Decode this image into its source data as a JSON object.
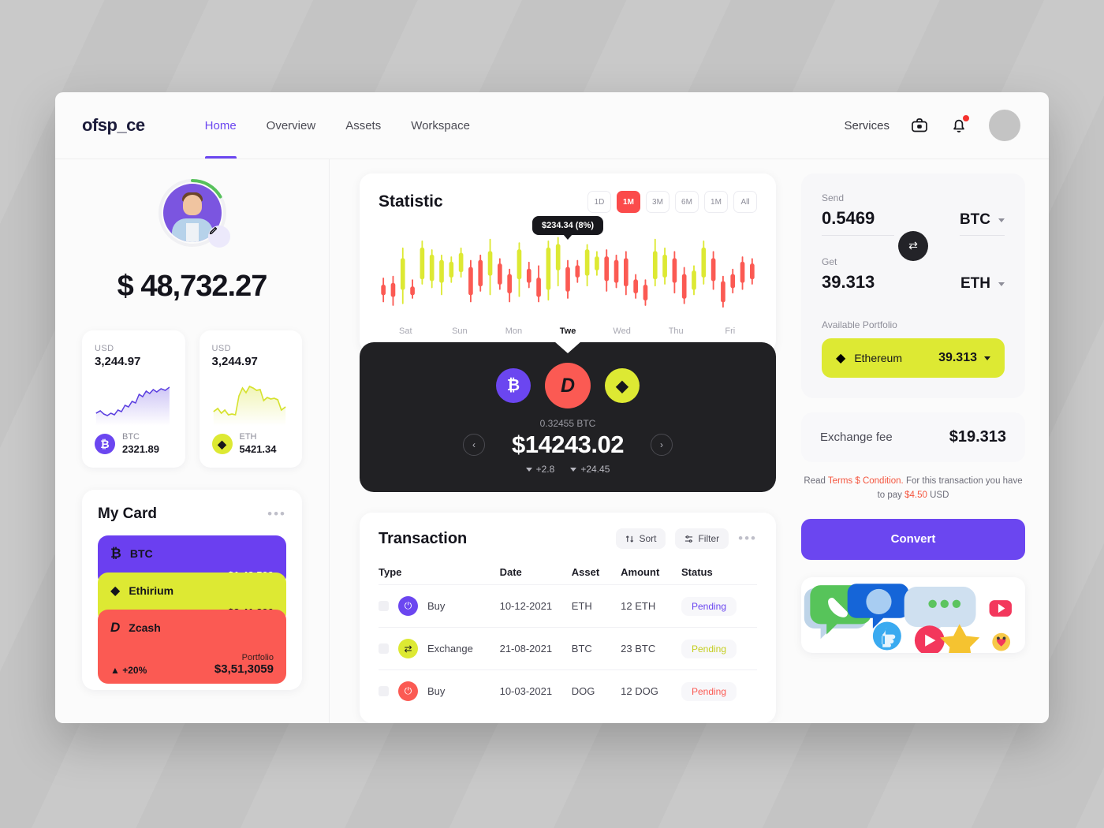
{
  "header": {
    "logo": "ofsp_ce",
    "nav": [
      {
        "label": "Home",
        "active": true
      },
      {
        "label": "Overview",
        "active": false
      },
      {
        "label": "Assets",
        "active": false
      },
      {
        "label": "Workspace",
        "active": false
      }
    ],
    "services_label": "Services",
    "icons": [
      "briefcase-icon",
      "bell-icon"
    ],
    "notification_color": "#f5322e"
  },
  "profile": {
    "balance": "$ 48,732.27",
    "ring_color": "#57c15c",
    "edit_icon": "pencil-icon"
  },
  "mini_cards": [
    {
      "currency": "USD",
      "value": "3,244.97",
      "symbol": "BTC",
      "amount": "2321.89",
      "color": "#6b46f0",
      "glyph": "₿",
      "spark_color": "#5b3fe0"
    },
    {
      "currency": "USD",
      "value": "3,244.97",
      "symbol": "ETH",
      "amount": "5421.34",
      "color": "#dde933",
      "glyph": "◆",
      "spark_color": "#d6e22f"
    }
  ],
  "my_card": {
    "title": "My Card",
    "menu_icon": "more-dots-icon",
    "cards": [
      {
        "name": "BTC",
        "amount": "$1,43,509",
        "color": "#6b3ff0",
        "glyph": "₿"
      },
      {
        "name": "Ethirium",
        "amount": "$3,41,890",
        "color": "#dde933",
        "glyph": "◆"
      },
      {
        "name": "Zcash",
        "amount": "",
        "color": "#fb5a53",
        "glyph": "D",
        "portfolio_label": "Portfolio",
        "portfolio_value": "$3,51,3059",
        "change": "+20%"
      }
    ]
  },
  "statistic": {
    "title": "Statistic",
    "ranges": [
      {
        "label": "1D",
        "active": false
      },
      {
        "label": "1M",
        "active": true
      },
      {
        "label": "3M",
        "active": false
      },
      {
        "label": "6M",
        "active": false
      },
      {
        "label": "1M",
        "active": false
      },
      {
        "label": "All",
        "active": false
      }
    ],
    "tooltip": "$234.34 (8%)",
    "active_range_color": "#fb4b4b"
  },
  "chart_data": {
    "type": "candlestick",
    "title": "Statistic",
    "xlabel": "",
    "ylabel": "",
    "grid": false,
    "categories": [
      "Sat",
      "Sun",
      "Mon",
      "Twe",
      "Wed",
      "Thu",
      "Fri"
    ],
    "active_category": "Twe",
    "annotation": "$234.34 (8%)",
    "up_color": "#dde933",
    "down_color": "#fb5a53",
    "candles": [
      {
        "open": 30,
        "close": 42,
        "low": 22,
        "high": 50,
        "dir": "down"
      },
      {
        "open": 28,
        "close": 44,
        "low": 18,
        "high": 52,
        "dir": "down"
      },
      {
        "open": 36,
        "close": 72,
        "low": 20,
        "high": 84,
        "dir": "up"
      },
      {
        "open": 30,
        "close": 40,
        "low": 26,
        "high": 48,
        "dir": "down"
      },
      {
        "open": 48,
        "close": 84,
        "low": 42,
        "high": 92,
        "dir": "up"
      },
      {
        "open": 46,
        "close": 76,
        "low": 38,
        "high": 82,
        "dir": "up"
      },
      {
        "open": 44,
        "close": 70,
        "low": 30,
        "high": 76,
        "dir": "up"
      },
      {
        "open": 50,
        "close": 68,
        "low": 44,
        "high": 74,
        "dir": "up"
      },
      {
        "open": 56,
        "close": 78,
        "low": 50,
        "high": 84,
        "dir": "up"
      },
      {
        "open": 30,
        "close": 62,
        "low": 22,
        "high": 70,
        "dir": "down"
      },
      {
        "open": 40,
        "close": 70,
        "low": 34,
        "high": 76,
        "dir": "down"
      },
      {
        "open": 52,
        "close": 80,
        "low": 30,
        "high": 94,
        "dir": "up"
      },
      {
        "open": 42,
        "close": 66,
        "low": 36,
        "high": 72,
        "dir": "down"
      },
      {
        "open": 32,
        "close": 54,
        "low": 22,
        "high": 60,
        "dir": "down"
      },
      {
        "open": 48,
        "close": 82,
        "low": 28,
        "high": 90,
        "dir": "up"
      },
      {
        "open": 44,
        "close": 60,
        "low": 38,
        "high": 68,
        "dir": "down"
      },
      {
        "open": 28,
        "close": 50,
        "low": 22,
        "high": 64,
        "dir": "down"
      },
      {
        "open": 36,
        "close": 84,
        "low": 24,
        "high": 92,
        "dir": "up"
      },
      {
        "open": 58,
        "close": 88,
        "low": 40,
        "high": 96,
        "dir": "up"
      },
      {
        "open": 34,
        "close": 62,
        "low": 26,
        "high": 70,
        "dir": "down"
      },
      {
        "open": 50,
        "close": 64,
        "low": 44,
        "high": 70,
        "dir": "down"
      },
      {
        "open": 52,
        "close": 82,
        "low": 40,
        "high": 88,
        "dir": "up"
      },
      {
        "open": 58,
        "close": 74,
        "low": 52,
        "high": 80,
        "dir": "up"
      },
      {
        "open": 46,
        "close": 74,
        "low": 34,
        "high": 82,
        "dir": "down"
      },
      {
        "open": 44,
        "close": 70,
        "low": 38,
        "high": 76,
        "dir": "down"
      },
      {
        "open": 40,
        "close": 72,
        "low": 30,
        "high": 80,
        "dir": "down"
      },
      {
        "open": 32,
        "close": 48,
        "low": 26,
        "high": 54,
        "dir": "down"
      },
      {
        "open": 24,
        "close": 42,
        "low": 18,
        "high": 48,
        "dir": "down"
      },
      {
        "open": 48,
        "close": 80,
        "low": 40,
        "high": 94,
        "dir": "up"
      },
      {
        "open": 50,
        "close": 76,
        "low": 42,
        "high": 84,
        "dir": "up"
      },
      {
        "open": 44,
        "close": 72,
        "low": 32,
        "high": 80,
        "dir": "down"
      },
      {
        "open": 26,
        "close": 54,
        "low": 20,
        "high": 62,
        "dir": "down"
      },
      {
        "open": 36,
        "close": 58,
        "low": 30,
        "high": 64,
        "dir": "up"
      },
      {
        "open": 50,
        "close": 84,
        "low": 42,
        "high": 92,
        "dir": "up"
      },
      {
        "open": 46,
        "close": 72,
        "low": 36,
        "high": 80,
        "dir": "down"
      },
      {
        "open": 22,
        "close": 46,
        "low": 16,
        "high": 52,
        "dir": "down"
      },
      {
        "open": 38,
        "close": 54,
        "low": 32,
        "high": 60,
        "dir": "down"
      },
      {
        "open": 44,
        "close": 68,
        "low": 36,
        "high": 74,
        "dir": "down"
      },
      {
        "open": 48,
        "close": 66,
        "low": 42,
        "high": 72,
        "dir": "down"
      }
    ]
  },
  "coin_panel": {
    "coins": [
      {
        "name": "BTC",
        "color": "#6b46f0",
        "glyph": "₿",
        "lead": false
      },
      {
        "name": "Dash",
        "color": "#fb5a53",
        "glyph": "D",
        "lead": true
      },
      {
        "name": "ETH",
        "color": "#dde933",
        "glyph": "◆",
        "lead": false
      }
    ],
    "sub": "0.32455 BTC",
    "amount": "$14243.02",
    "deltas": [
      "+2.8",
      "+24.45"
    ],
    "prev_icon": "chevron-left-icon",
    "next_icon": "chevron-right-icon"
  },
  "transaction": {
    "title": "Transaction",
    "sort_label": "Sort",
    "filter_label": "Filter",
    "menu_icon": "more-dots-icon",
    "columns": [
      "Type",
      "Date",
      "Asset",
      "Amount",
      "Status"
    ],
    "rows": [
      {
        "type": "Buy",
        "date": "10-12-2021",
        "asset": "ETH",
        "amount": "12 ETH",
        "status": "Pending",
        "icon_color": "#6b46f0",
        "status_color": "#6b46f0",
        "icon": "power-icon"
      },
      {
        "type": "Exchange",
        "date": "21-08-2021",
        "asset": "BTC",
        "amount": "23 BTC",
        "status": "Pending",
        "icon_color": "#dde933",
        "status_color": "#c4ce1f",
        "icon": "swap-icon"
      },
      {
        "type": "Buy",
        "date": "10-03-2021",
        "asset": "DOG",
        "amount": "12 DOG",
        "status": "Pending",
        "icon_color": "#fb5a53",
        "status_color": "#fb5a53",
        "icon": "power-icon"
      }
    ]
  },
  "exchange": {
    "send_label": "Send",
    "send_value": "0.5469",
    "send_currency": "BTC",
    "get_label": "Get",
    "get_value": "39.313",
    "get_currency": "ETH",
    "swap_icon": "swap-arrows-icon",
    "portfolio_label": "Available Portfolio",
    "portfolio_asset": "Ethereum",
    "portfolio_amount": "39.313",
    "portfolio_color": "#dde933",
    "fee_label": "Exchange fee",
    "fee_value": "$19.313",
    "terms_prefix": "Read ",
    "terms_link": "Terms $ Condition.",
    "terms_mid": " For this transaction you have to pay ",
    "terms_price": "$4.50",
    "terms_suffix": " USD",
    "convert_label": "Convert",
    "convert_color": "#6b46f0"
  },
  "promo": {
    "name": "social-icons-banner"
  }
}
